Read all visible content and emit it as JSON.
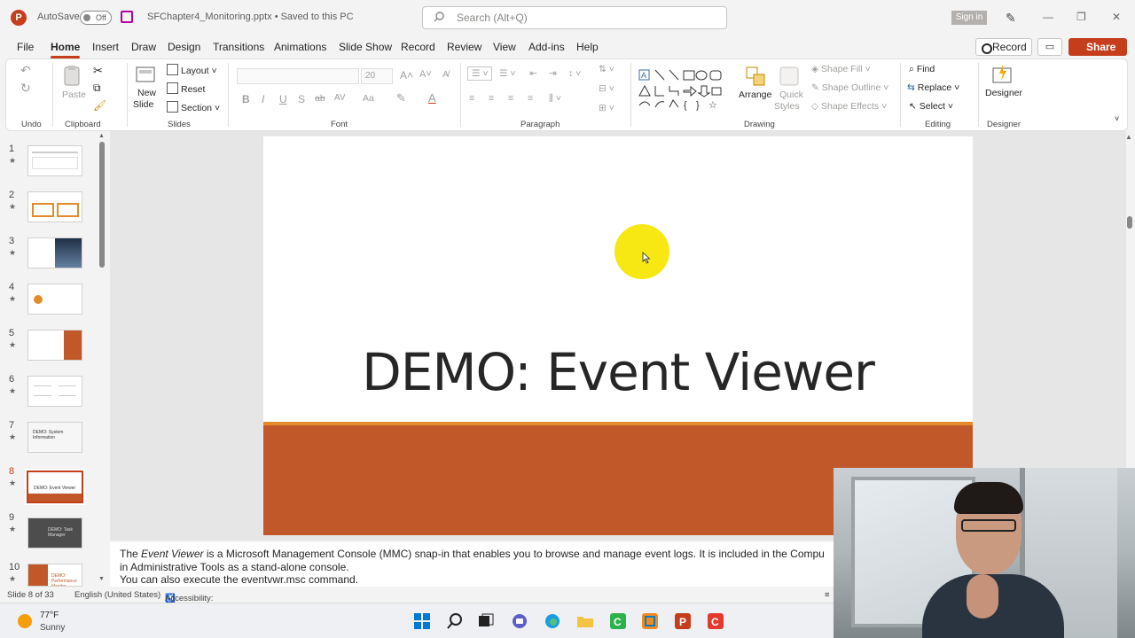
{
  "titlebar": {
    "app_logo": "P",
    "autosave_label": "AutoSave",
    "autosave_state": "Off",
    "doc_title": "SFChapter4_Monitoring.pptx • Saved to this PC",
    "search_placeholder": "Search (Alt+Q)",
    "signin_label": "Sign in"
  },
  "menu": {
    "tabs": [
      "File",
      "Home",
      "Insert",
      "Draw",
      "Design",
      "Transitions",
      "Animations",
      "Slide Show",
      "Record",
      "Review",
      "View",
      "Add-ins",
      "Help"
    ],
    "active_tab": "Home",
    "record_label": "Record",
    "share_label": "Share"
  },
  "ribbon": {
    "groups": {
      "undo": "Undo",
      "clipboard": "Clipboard",
      "slides": "Slides",
      "font": "Font",
      "paragraph": "Paragraph",
      "drawing": "Drawing",
      "editing": "Editing",
      "designer": "Designer"
    },
    "paste_label": "Paste",
    "new_slide_label_1": "New",
    "new_slide_label_2": "Slide",
    "layout_label": "Layout",
    "reset_label": "Reset",
    "section_label": "Section",
    "font_size_value": "20",
    "arrange_label": "Arrange",
    "quick_styles_label_1": "Quick",
    "quick_styles_label_2": "Styles",
    "shape_fill_label": "Shape Fill",
    "shape_outline_label": "Shape Outline",
    "shape_effects_label": "Shape Effects",
    "find_label": "Find",
    "replace_label": "Replace",
    "select_label": "Select",
    "designer_label": "Designer"
  },
  "thumbnails": [
    {
      "num": "1",
      "text": ""
    },
    {
      "num": "2",
      "text": ""
    },
    {
      "num": "3",
      "text": ""
    },
    {
      "num": "4",
      "text": ""
    },
    {
      "num": "5",
      "text": ""
    },
    {
      "num": "6",
      "text": ""
    },
    {
      "num": "7",
      "text": "DEMO: System Information"
    },
    {
      "num": "8",
      "text": "DEMO: Event Viewer"
    },
    {
      "num": "9",
      "text": "DEMO: Task Manager"
    },
    {
      "num": "10",
      "text": "DEMO: Performance Monitor"
    }
  ],
  "slide": {
    "title": "DEMO: Event Viewer"
  },
  "notes": {
    "line1_prefix": "The ",
    "line1_italic": "Event Viewer",
    "line1_rest": " is a Microsoft Management Console (MMC) snap-in that enables you to browse and manage event logs. It is included in the Compu",
    "line2": "in Administrative Tools as a stand-alone console.",
    "line3": "You can also execute the eventvwr.msc command."
  },
  "statusbar": {
    "slide_count": "Slide 8 of 33",
    "language": "English (United States)",
    "accessibility": "Accessibility: Investigate"
  },
  "taskbar": {
    "temperature": "77°F",
    "condition": "Sunny"
  },
  "colors": {
    "accent": "#c43e1c",
    "band": "#c0582a",
    "band_line": "#e38b2a",
    "cursor_highlight": "#f7e813"
  }
}
